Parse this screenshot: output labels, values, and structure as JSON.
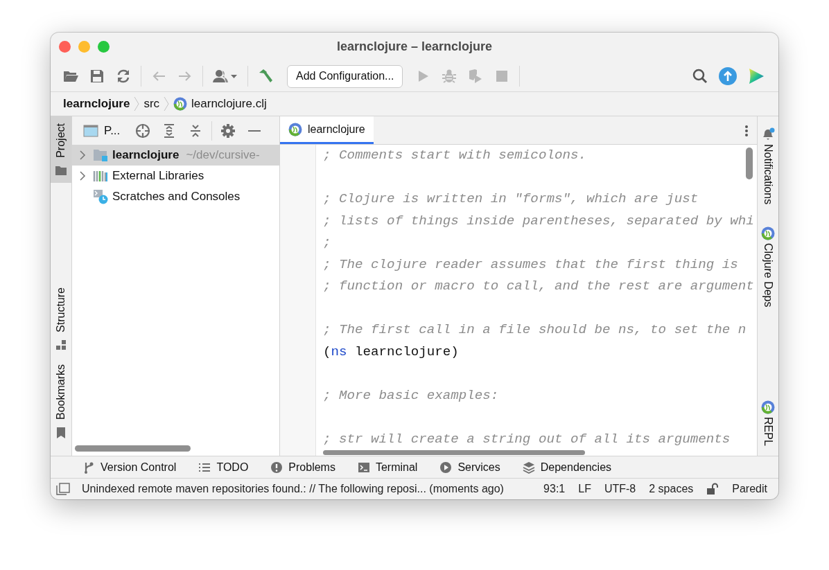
{
  "window": {
    "title": "learnclojure – learnclojure"
  },
  "toolbar": {
    "left": [
      {
        "kind": "open",
        "disabled": false
      },
      {
        "kind": "save",
        "disabled": false
      },
      {
        "kind": "sync",
        "disabled": false
      },
      {
        "kind": "separator"
      },
      {
        "kind": "back",
        "disabled": true
      },
      {
        "kind": "forward",
        "disabled": true
      },
      {
        "kind": "separator"
      },
      {
        "kind": "user",
        "disabled": false
      },
      {
        "kind": "separator"
      },
      {
        "kind": "build",
        "disabled": false
      }
    ],
    "run_configuration": "Add Configuration...",
    "run": [
      {
        "kind": "run",
        "disabled": true
      },
      {
        "kind": "debug",
        "disabled": true
      },
      {
        "kind": "coverage",
        "disabled": true
      },
      {
        "kind": "stop",
        "disabled": true
      },
      {
        "kind": "separator"
      }
    ],
    "right": [
      {
        "kind": "search"
      },
      {
        "kind": "update"
      },
      {
        "kind": "logo"
      }
    ]
  },
  "breadcrumbs": [
    {
      "label": "learnclojure",
      "kind": "project"
    },
    {
      "label": "src",
      "kind": "folder"
    },
    {
      "label": "learnclojure.clj",
      "kind": "file"
    }
  ],
  "left_stripe": [
    {
      "label": "Project",
      "kind": "project",
      "selected": true
    },
    {
      "label": "Structure",
      "kind": "structure",
      "selected": false
    },
    {
      "label": "Bookmarks",
      "kind": "bookmarks",
      "selected": false
    }
  ],
  "project_panel": {
    "title": "P...",
    "tools": [
      {
        "kind": "locate"
      },
      {
        "kind": "expand"
      },
      {
        "kind": "collapse"
      },
      {
        "kind": "separator"
      },
      {
        "kind": "settings"
      },
      {
        "kind": "hide"
      }
    ],
    "tree": [
      {
        "label": "learnclojure",
        "hint": "~/dev/cursive-",
        "kind": "module",
        "leaf": false,
        "expanded": false,
        "selected": true
      },
      {
        "label": "External Libraries",
        "kind": "libraries",
        "leaf": false,
        "expanded": false,
        "selected": false
      },
      {
        "label": "Scratches and Consoles",
        "kind": "scratches",
        "leaf": true,
        "selected": false
      }
    ]
  },
  "editor": {
    "tabs": [
      {
        "label": "learnclojure",
        "selected": true
      }
    ],
    "lines": [
      {
        "kind": "comment",
        "text": "; Comments start with semicolons."
      },
      {
        "kind": "blank"
      },
      {
        "kind": "comment",
        "text": "; Clojure is written in \"forms\", which are just"
      },
      {
        "kind": "comment",
        "text": "; lists of things inside parentheses, separated by whi"
      },
      {
        "kind": "comment",
        "text": ";"
      },
      {
        "kind": "comment",
        "text": "; The clojure reader assumes that the first thing is"
      },
      {
        "kind": "comment",
        "text": "; function or macro to call, and the rest are argument"
      },
      {
        "kind": "blank"
      },
      {
        "kind": "comment",
        "text": "; The first call in a file should be ns, to set the n"
      },
      {
        "kind": "code",
        "tokens": [
          {
            "kind": "plain",
            "text": "("
          },
          {
            "kind": "keyword",
            "text": "ns"
          },
          {
            "kind": "plain",
            "text": " learnclojure)"
          }
        ]
      },
      {
        "kind": "blank"
      },
      {
        "kind": "comment",
        "text": "; More basic examples:"
      },
      {
        "kind": "blank"
      },
      {
        "kind": "comment",
        "text": "; str will create a string out of all its arguments"
      }
    ]
  },
  "right_stripe": [
    {
      "label": "Notifications",
      "kind": "notifications"
    },
    {
      "label": "Clojure Deps",
      "kind": "clojure"
    },
    {
      "label": "REPL",
      "kind": "clojure"
    }
  ],
  "tool_windows": [
    {
      "label": "Version Control",
      "kind": "vcs"
    },
    {
      "label": "TODO",
      "kind": "todo"
    },
    {
      "label": "Problems",
      "kind": "problems"
    },
    {
      "label": "Terminal",
      "kind": "terminal"
    },
    {
      "label": "Services",
      "kind": "services"
    },
    {
      "label": "Dependencies",
      "kind": "dependencies"
    }
  ],
  "status_bar": {
    "message": "Unindexed remote maven repositories found.: // The following reposi... (moments ago)",
    "position": "93:1",
    "line_separator": "LF",
    "encoding": "UTF-8",
    "indent": "2 spaces",
    "mode": "Paredit"
  }
}
